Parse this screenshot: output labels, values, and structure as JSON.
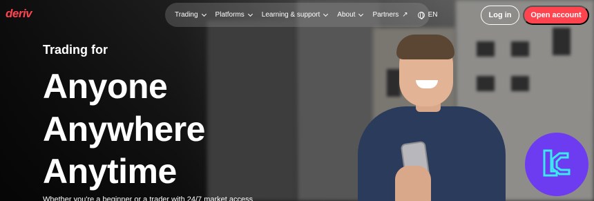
{
  "brand": {
    "logo_text": "deriv",
    "accent_color": "#ff444f"
  },
  "nav": {
    "items": [
      {
        "label": "Trading",
        "has_dropdown": true
      },
      {
        "label": "Platforms",
        "has_dropdown": true
      },
      {
        "label": "Learning & support",
        "has_dropdown": true
      },
      {
        "label": "About",
        "has_dropdown": true
      },
      {
        "label": "Partners",
        "icon": "external-arrow-icon"
      }
    ],
    "language": {
      "label": "EN",
      "icon": "globe-icon"
    }
  },
  "actions": {
    "login_label": "Log in",
    "open_account_label": "Open account"
  },
  "hero": {
    "eyebrow": "Trading for",
    "line1": "Anyone",
    "line2": "Anywhere",
    "line3": "Anytime",
    "subtext": "Whether you're a beginner or a trader with 24/7 market access"
  },
  "badge": {
    "icon": "tc-logo-icon",
    "color": "#6e3cf0"
  }
}
